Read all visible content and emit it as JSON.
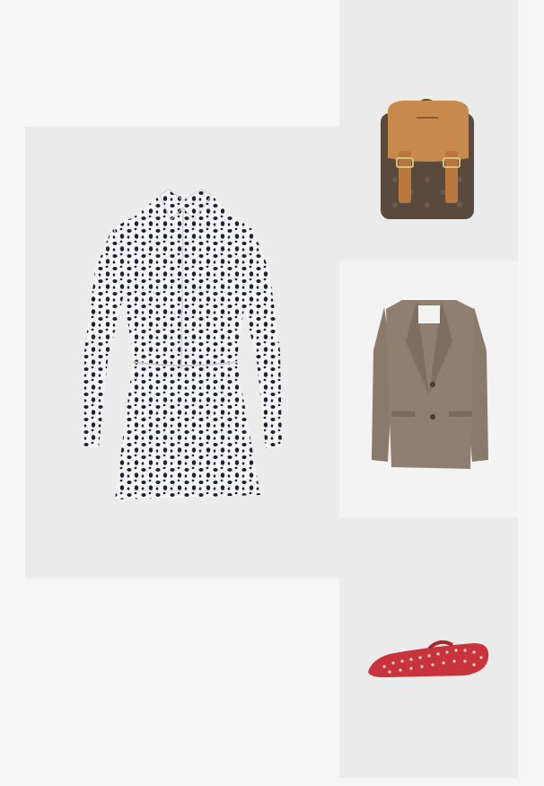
{
  "products": [
    {
      "id": "dress",
      "icon": "leopard-print-shirt-dress-image",
      "colors": {
        "base": "#f4f4f6",
        "spots": "#1f2030"
      }
    },
    {
      "id": "backpack",
      "icon": "monogram-backpack-image",
      "colors": {
        "body": "#5a4a3e",
        "flap": "#c88a4c"
      }
    },
    {
      "id": "blazer",
      "icon": "houndstooth-blazer-image",
      "colors": {
        "body": "#8f7f70"
      }
    },
    {
      "id": "shoes",
      "icon": "studded-mary-jane-flat-image",
      "colors": {
        "body": "#c8343c",
        "studs": "#e8d8d0"
      }
    }
  ]
}
